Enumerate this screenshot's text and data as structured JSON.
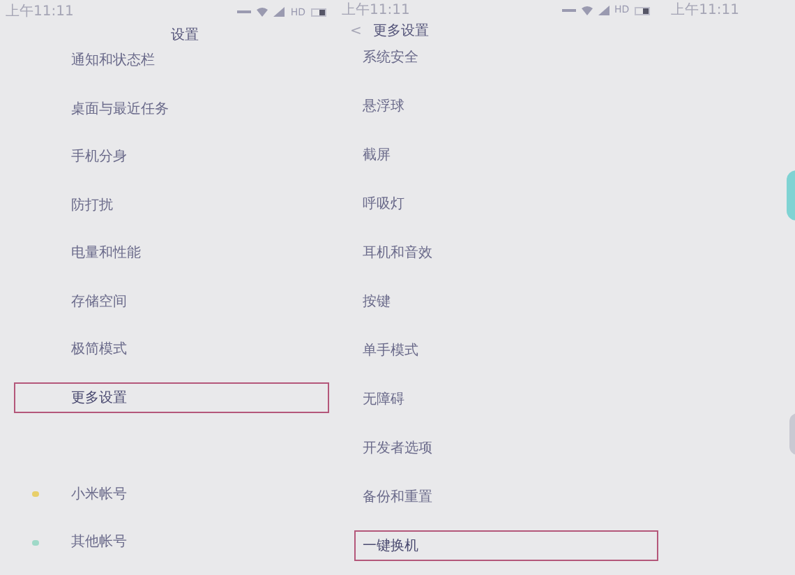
{
  "left_screen": {
    "status_bar": {
      "time": "上午11:11",
      "network": "HD"
    },
    "title": "设置",
    "items": [
      {
        "label": "通知和状态栏",
        "selected": false
      },
      {
        "label": "桌面与最近任务",
        "selected": false
      },
      {
        "label": "手机分身",
        "selected": false
      },
      {
        "label": "防打扰",
        "selected": false
      },
      {
        "label": "电量和性能",
        "selected": false
      },
      {
        "label": "存储空间",
        "selected": false
      },
      {
        "label": "极简模式",
        "selected": false
      },
      {
        "label": "更多设置",
        "selected": true
      },
      {
        "kind": "spacer"
      },
      {
        "label": "小米帐号",
        "kind": "account",
        "color": "#e8cf6a",
        "selected": false
      },
      {
        "label": "其他帐号",
        "kind": "account",
        "color": "#9fd9c8",
        "selected": false
      }
    ]
  },
  "right_screen": {
    "status_bar": {
      "time": "上午11:11",
      "network": "HD",
      "second_time": "上午11:11"
    },
    "title": "更多设置",
    "back": "<",
    "items": [
      {
        "label": "系统安全",
        "selected": false
      },
      {
        "label": "悬浮球",
        "selected": false
      },
      {
        "label": "截屏",
        "selected": false
      },
      {
        "label": "呼吸灯",
        "selected": false
      },
      {
        "label": "耳机和音效",
        "selected": false
      },
      {
        "label": "按键",
        "selected": false
      },
      {
        "label": "单手模式",
        "selected": false
      },
      {
        "label": "无障碍",
        "selected": false
      },
      {
        "label": "开发者选项",
        "selected": false
      },
      {
        "label": "备份和重置",
        "selected": false
      },
      {
        "label": "一键换机",
        "selected": true
      }
    ]
  }
}
